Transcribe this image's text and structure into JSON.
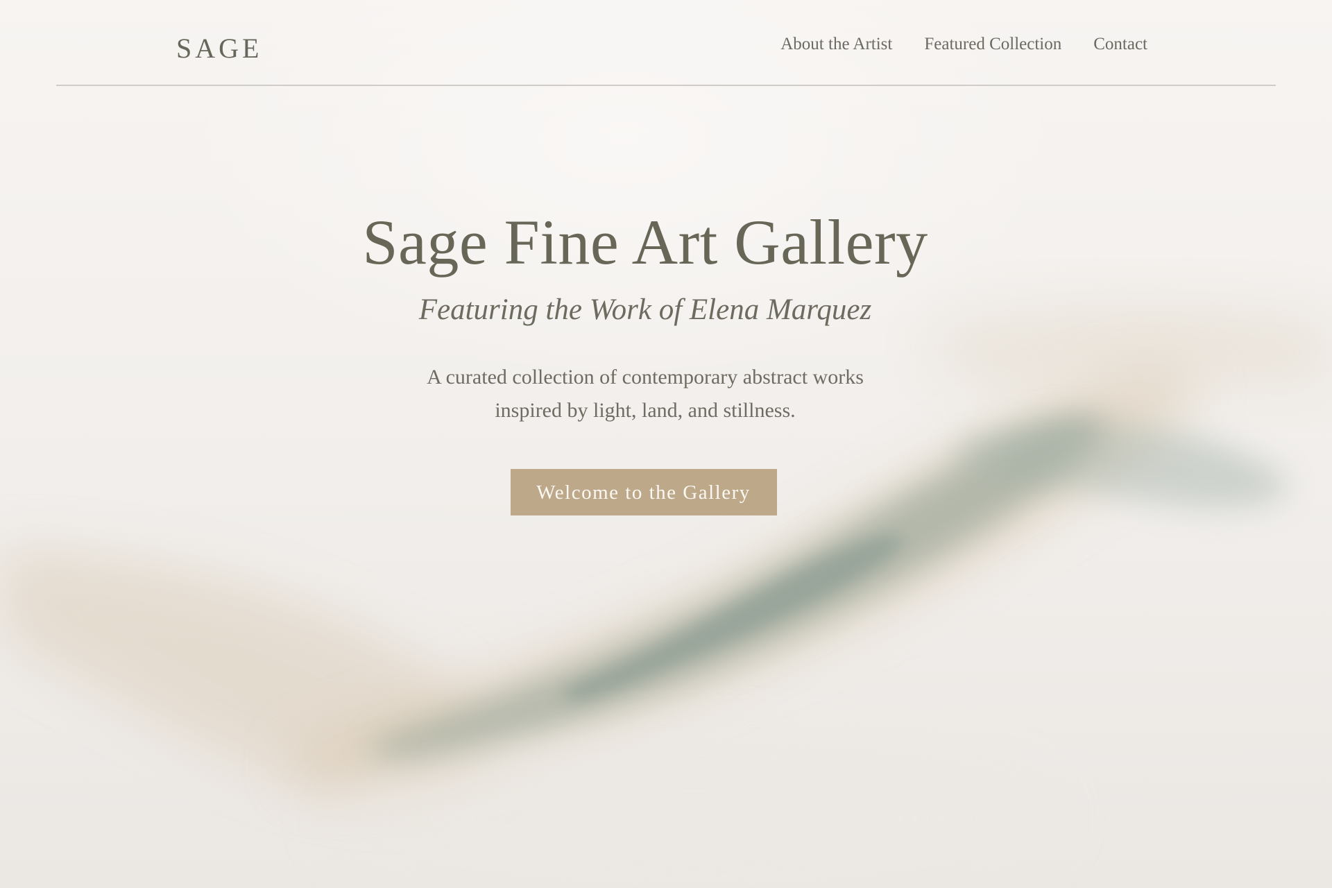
{
  "header": {
    "brand": "SAGE",
    "nav": [
      {
        "label": "About the Artist"
      },
      {
        "label": "Featured Collection"
      },
      {
        "label": "Contact"
      }
    ]
  },
  "hero": {
    "title": "Sage Fine Art Gallery",
    "subtitle": "Featuring the Work of Elena Marquez",
    "description_line1": "A curated collection of contemporary abstract works",
    "description_line2": "inspired by light, land, and stillness.",
    "cta_label": "Welcome to the Gallery"
  },
  "colors": {
    "background": "#f5f2ef",
    "text": "#6b6a5f",
    "accent_button": "#bda88a",
    "button_text": "#fbf8f3",
    "brushstroke_sage": "#8a9b90",
    "brushstroke_sand": "#d6c5ac",
    "divider": "#cfcbc6"
  }
}
